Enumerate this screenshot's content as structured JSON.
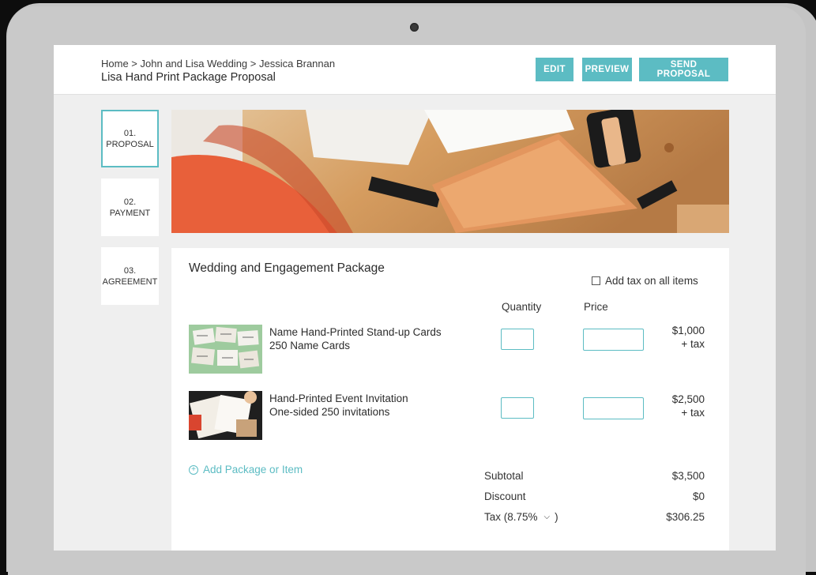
{
  "header": {
    "breadcrumb": [
      "Home",
      "John and Lisa Wedding",
      "Jessica Brannan"
    ],
    "breadcrumb_sep": " > ",
    "title": "Lisa Hand Print Package Proposal",
    "buttons": {
      "edit": "EDIT",
      "preview": "PREVIEW",
      "send": "SEND PROPOSAL"
    }
  },
  "steps": [
    {
      "number": "01.",
      "label": "PROPOSAL",
      "active": true
    },
    {
      "number": "02.",
      "label": "PAYMENT",
      "active": false
    },
    {
      "number": "03.",
      "label": "AGREEMENT",
      "active": false
    }
  ],
  "package": {
    "title": "Wedding and Engagement Package",
    "tax_all_label": "Add tax on all items",
    "columns": {
      "quantity": "Quantity",
      "price": "Price"
    },
    "items": [
      {
        "name": "Name Hand-Printed Stand-up Cards",
        "detail": "250 Name Cards",
        "amount": "$1,000",
        "tax": "+ tax"
      },
      {
        "name": "Hand-Printed Event Invitation",
        "detail": "One-sided 250 invitations",
        "amount": "$2,500",
        "tax": "+ tax"
      }
    ],
    "add_item": "Add Package or Item",
    "summary": {
      "subtotal_label": "Subtotal",
      "subtotal": "$3,500",
      "discount_label": "Discount",
      "discount": "$0",
      "tax_label": "Tax (8.75%",
      "tax_close": ")",
      "tax": "$306.25"
    }
  },
  "colors": {
    "accent": "#5cbcc3"
  }
}
